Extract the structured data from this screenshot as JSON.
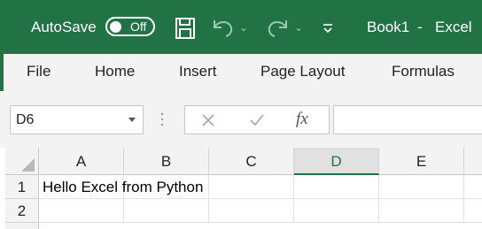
{
  "titlebar": {
    "autosave_label": "AutoSave",
    "autosave_state": "Off",
    "doc_title": "Book1",
    "separator": "-",
    "app_name": "Excel",
    "icons": [
      "save-icon",
      "undo-icon",
      "redo-icon",
      "customize-qat-icon"
    ]
  },
  "ribbon": {
    "tabs": [
      "File",
      "Home",
      "Insert",
      "Page Layout",
      "Formulas"
    ]
  },
  "formula_bar": {
    "name_box": "D6",
    "fx_label": "fx",
    "formula_value": ""
  },
  "sheet": {
    "columns": [
      "A",
      "B",
      "C",
      "D",
      "E"
    ],
    "selected_column": "D",
    "rows": [
      "1",
      "2"
    ],
    "cells": {
      "A1": "Hello Excel from Python"
    }
  },
  "colors": {
    "accent": "#217346",
    "ribbon_bg": "#f3f3f3"
  }
}
